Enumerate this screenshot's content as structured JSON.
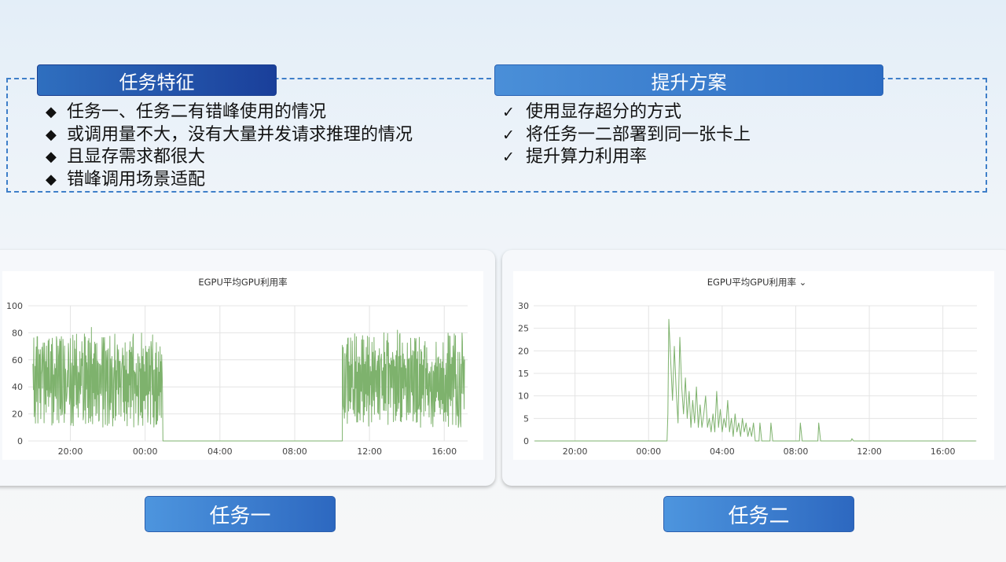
{
  "features": {
    "title": "任务特征",
    "items": [
      "任务一、任务二有错峰使用的情况",
      "或调用量不大，没有大量并发请求推理的情况",
      "且显存需求都很大",
      "错峰调用场景适配"
    ],
    "marker": "◆"
  },
  "plan": {
    "title": "提升方案",
    "items": [
      "使用显存超分的方式",
      "将任务一二部署到同一张卡上",
      "提升算力利用率"
    ],
    "marker": "✓"
  },
  "labels": {
    "task1": "任务一",
    "task2": "任务二"
  },
  "chart_data": [
    {
      "type": "line",
      "title": "EGPU平均GPU利用率",
      "xlabel": "",
      "ylabel": "",
      "x_ticks": [
        "20:00",
        "00:00",
        "04:00",
        "08:00",
        "12:00",
        "16:00"
      ],
      "y_ticks": [
        0,
        20,
        40,
        60,
        80,
        100
      ],
      "ylim": [
        0,
        100
      ],
      "x_range_hours": [
        17.75,
        41.25
      ],
      "line_color": "#7eb26d",
      "grid": true,
      "segments": [
        {
          "start_hour": 18.0,
          "end_hour": 24.95,
          "value_range": [
            10,
            80
          ],
          "peak": 84,
          "note": "high oscillating utilization"
        },
        {
          "start_hour": 24.95,
          "end_hour": 34.55,
          "value": 0
        },
        {
          "start_hour": 34.55,
          "end_hour": 41.1,
          "value_range": [
            10,
            80
          ],
          "peak": 82,
          "note": "high oscillating utilization"
        }
      ]
    },
    {
      "type": "line",
      "title": "EGPU平均GPU利用率",
      "title_suffix": "⌄",
      "xlabel": "",
      "ylabel": "",
      "x_ticks": [
        "20:00",
        "00:00",
        "04:00",
        "08:00",
        "12:00",
        "16:00"
      ],
      "y_ticks": [
        0,
        5,
        10,
        15,
        20,
        25,
        30
      ],
      "ylim": [
        0,
        30
      ],
      "x_range_hours": [
        17.75,
        41.85
      ],
      "line_color": "#7eb26d",
      "grid": true,
      "points": [
        [
          17.8,
          0
        ],
        [
          25.0,
          0
        ],
        [
          25.05,
          6
        ],
        [
          25.1,
          27
        ],
        [
          25.2,
          18
        ],
        [
          25.3,
          9
        ],
        [
          25.4,
          21
        ],
        [
          25.5,
          11
        ],
        [
          25.6,
          4
        ],
        [
          25.7,
          23
        ],
        [
          25.8,
          12
        ],
        [
          25.9,
          6
        ],
        [
          26.0,
          14
        ],
        [
          26.1,
          5
        ],
        [
          26.2,
          11
        ],
        [
          26.3,
          3
        ],
        [
          26.4,
          9
        ],
        [
          26.5,
          4
        ],
        [
          26.6,
          12
        ],
        [
          26.7,
          3
        ],
        [
          26.8,
          8
        ],
        [
          26.9,
          3
        ],
        [
          27.0,
          6
        ],
        [
          27.1,
          10
        ],
        [
          27.2,
          3
        ],
        [
          27.3,
          5
        ],
        [
          27.4,
          2
        ],
        [
          27.5,
          6
        ],
        [
          27.6,
          2
        ],
        [
          27.7,
          11
        ],
        [
          27.8,
          3
        ],
        [
          27.9,
          7
        ],
        [
          28.0,
          2
        ],
        [
          28.1,
          5
        ],
        [
          28.2,
          3
        ],
        [
          28.3,
          9
        ],
        [
          28.4,
          2
        ],
        [
          28.5,
          5
        ],
        [
          28.6,
          1
        ],
        [
          28.7,
          6
        ],
        [
          28.8,
          2
        ],
        [
          28.9,
          4
        ],
        [
          29.0,
          1
        ],
        [
          29.1,
          5
        ],
        [
          29.2,
          2
        ],
        [
          29.3,
          4
        ],
        [
          29.4,
          1
        ],
        [
          29.5,
          3
        ],
        [
          29.6,
          1
        ],
        [
          29.7,
          4
        ],
        [
          29.8,
          0
        ],
        [
          30.0,
          0
        ],
        [
          30.05,
          4
        ],
        [
          30.15,
          0
        ],
        [
          30.6,
          0
        ],
        [
          30.65,
          4
        ],
        [
          30.75,
          0
        ],
        [
          32.2,
          0
        ],
        [
          32.25,
          4
        ],
        [
          32.35,
          0
        ],
        [
          33.2,
          0
        ],
        [
          33.25,
          4
        ],
        [
          33.35,
          0
        ],
        [
          35.0,
          0
        ],
        [
          35.05,
          0.5
        ],
        [
          35.15,
          0
        ],
        [
          41.8,
          0
        ]
      ]
    }
  ]
}
